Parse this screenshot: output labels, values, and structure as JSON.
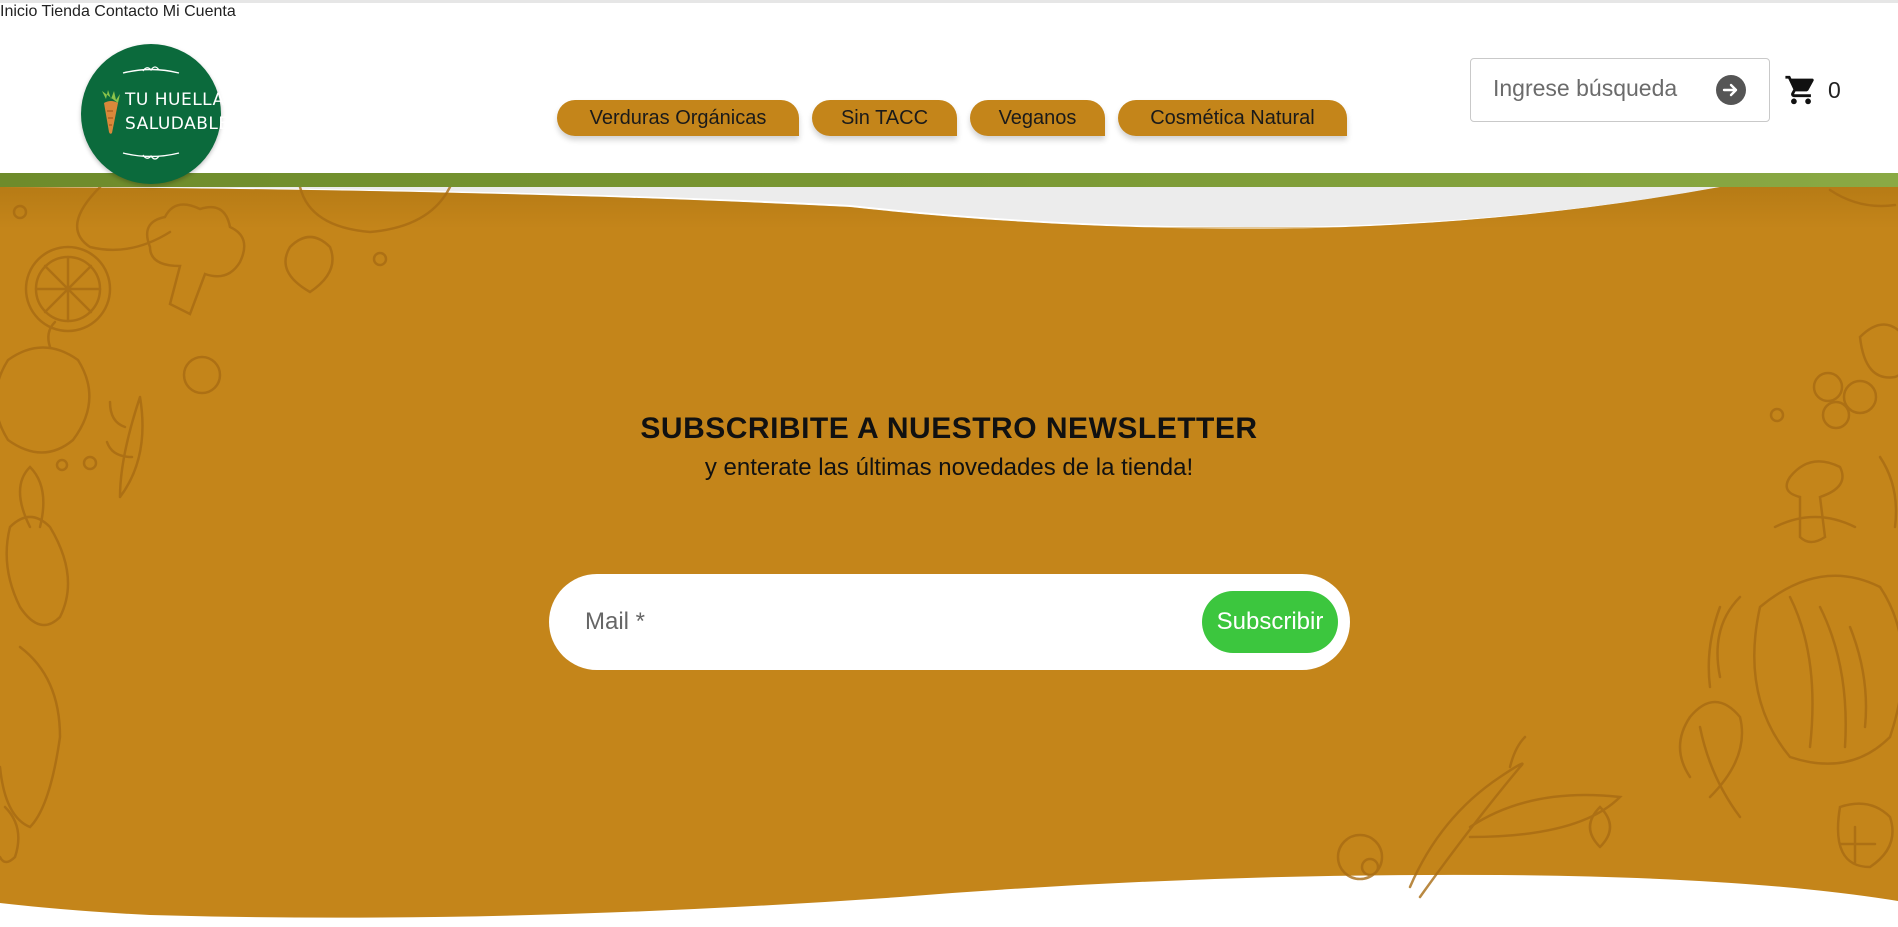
{
  "brand": {
    "name_line1": "TU HUELLA",
    "name_line2": "SALUDABLE",
    "color": "#0b6a3c"
  },
  "nav": {
    "items": [
      {
        "label": "Inicio"
      },
      {
        "label": "Tienda"
      },
      {
        "label": "Contacto"
      },
      {
        "label": "Mi Cuenta"
      }
    ]
  },
  "categories": [
    {
      "label": "Verduras Orgánicas"
    },
    {
      "label": "Sin TACC"
    },
    {
      "label": "Veganos"
    },
    {
      "label": "Cosmética Natural"
    }
  ],
  "search": {
    "placeholder": "Ingrese búsqueda",
    "icon": "arrow-right-circle-icon"
  },
  "cart": {
    "icon": "cart-icon",
    "count": "0"
  },
  "newsletter": {
    "title": "SUBSCRIBITE A NUESTRO NEWSLETTER",
    "subtitle": "y enteratе las últimas novedades de la tienda!",
    "email_placeholder": "Mail *",
    "button_label": "Subscribir"
  },
  "colors": {
    "accent_mustard": "#c4851a",
    "green_bar": "#7a9833",
    "subscribe_button": "#3cc63e"
  }
}
